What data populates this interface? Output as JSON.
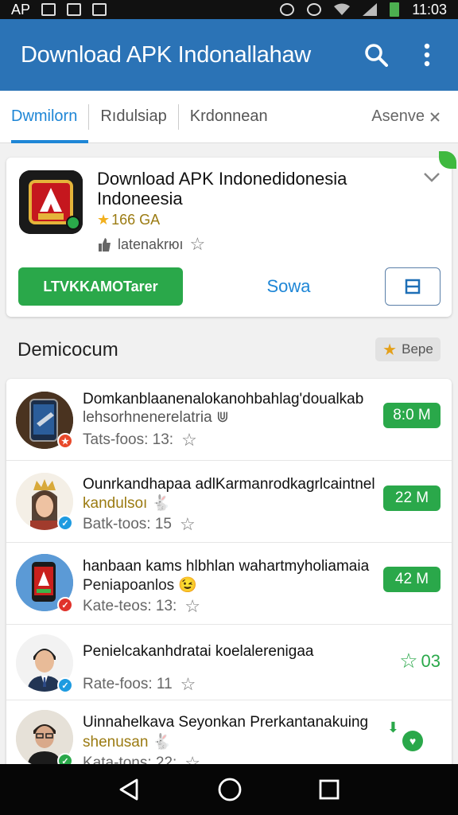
{
  "status_bar": {
    "left_text": "AP",
    "time": "11:03"
  },
  "app_bar": {
    "title": "Download APK Indonallahaw"
  },
  "tabs": [
    {
      "label": "Dwmilorn",
      "active": true
    },
    {
      "label": "Rıdulsiap",
      "active": false
    },
    {
      "label": "Krdonnean",
      "active": false
    },
    {
      "label": "Asenve",
      "active": false
    }
  ],
  "hero": {
    "title": "Download APK  Indonedidonesia Indoneesia",
    "rating": "166 GA",
    "author": "latenakrюı",
    "install_label": "LTVKKAMOTarer",
    "show_label": "Sowa"
  },
  "section": {
    "title": "Demicocum",
    "badge": "Bepe"
  },
  "list": [
    {
      "title": "Domkanblaanenalokanohbahlag'doualkab",
      "subtitle": "lehsorhnenerelatria ⋓",
      "meta": "Tats-foos: 13:",
      "size": "8:0 M",
      "size_style": "pill",
      "badge_color": "#e8492b",
      "avatar": "phone-gun-avatar"
    },
    {
      "title": "Ounrkandhapaa adlKarmanrodkagrlcaintnel",
      "subtitle": "kandulsoı 🐇",
      "meta": "Batk-toos: 15",
      "size": "22 M",
      "size_style": "pill",
      "badge_color": "#1e9be0",
      "avatar": "woman-crown-avatar"
    },
    {
      "title": "hanbaan kams hlbhlan wahartmyholiamaia",
      "subtitle": "Peniapoanlos 😉",
      "meta": "Kate-teos: 13:",
      "size": "42 M",
      "size_style": "pill",
      "badge_color": "#e0322b",
      "avatar": "phone-game-avatar"
    },
    {
      "title": "Penielcakanhdratai koelalerenigaa",
      "subtitle": "",
      "meta": "Rate-foos: 11",
      "size": "03",
      "size_style": "plain",
      "badge_color": "#1e9be0",
      "avatar": "man-suit-avatar"
    },
    {
      "title": "Uinnahelkava Seyonkan Prerkantanakuing",
      "subtitle": "shenusan 🐇",
      "meta": "Kata-tons: 22:",
      "size": "",
      "size_style": "plain",
      "badge_color": "#2aa84a",
      "avatar": "man-glasses-avatar"
    }
  ],
  "colors": {
    "app_bar": "#2b73b6",
    "accent": "#1e86d6",
    "green": "#2aa84a"
  }
}
